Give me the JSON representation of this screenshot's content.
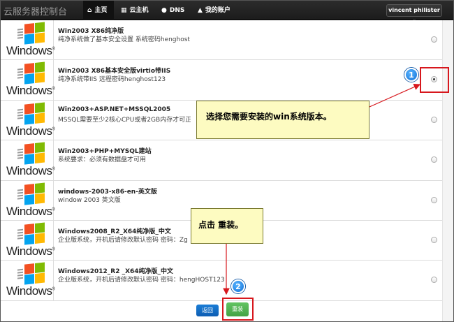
{
  "navbar": {
    "brand": "云服务器控制台",
    "items": [
      {
        "icon": "home-icon",
        "glyph": "⌂",
        "label": "主页"
      },
      {
        "icon": "cloud-server-icon",
        "glyph": "▦",
        "label": "云主机"
      },
      {
        "icon": "globe-icon",
        "glyph": "●",
        "label": "DNS"
      },
      {
        "icon": "user-icon",
        "glyph": "▲",
        "label": "我的账户"
      }
    ],
    "user_menu": "vincent philister ▾"
  },
  "logo_text": "Windows",
  "os_list": [
    {
      "title": "Win2003 X86纯净版",
      "desc": "纯净系统做了基本安全设置 系统密码henghost123",
      "checked": false
    },
    {
      "title": "Win2003 X86基本安全版virtio带IIS",
      "desc": "纯净系统带IIS 远程密码henghost123",
      "checked": true
    },
    {
      "title": "Win2003+ASP.NET+MSSQL2005",
      "desc": "MSSQL需要至少2核心CPU或者2GB内存才可正常",
      "checked": false
    },
    {
      "title": "Win2003+PHP+MYSQL建站",
      "desc": "系统要求：必须有数据盘才可用",
      "checked": false
    },
    {
      "title": "windows-2003-x86-en-英文版",
      "desc": "window 2003 英文版",
      "checked": false
    },
    {
      "title": "Windows2008_R2_X64纯净版_中文",
      "desc": "企业版系统，开机后请修改默认密码 密码：Zg",
      "checked": false
    },
    {
      "title": "Windows2012_R2 _X64纯净版_中文",
      "desc": "企业版系统，开机后请修改默认密码 密码：hengHOST123",
      "checked": false
    }
  ],
  "actions": {
    "back_label": "返回",
    "reinstall_label": "重装"
  },
  "annotations": {
    "badge1": "1",
    "badge2": "2",
    "callout1": "选择您需要安装的win系统版本。",
    "callout2": "点击 重装。"
  },
  "colors": {
    "navbar": "#1c1c1c",
    "back_button": "#0e5eb3",
    "reinstall_button": "#45a245",
    "annotation_red": "#d7171d",
    "callout_bg": "#fdfbc1"
  }
}
